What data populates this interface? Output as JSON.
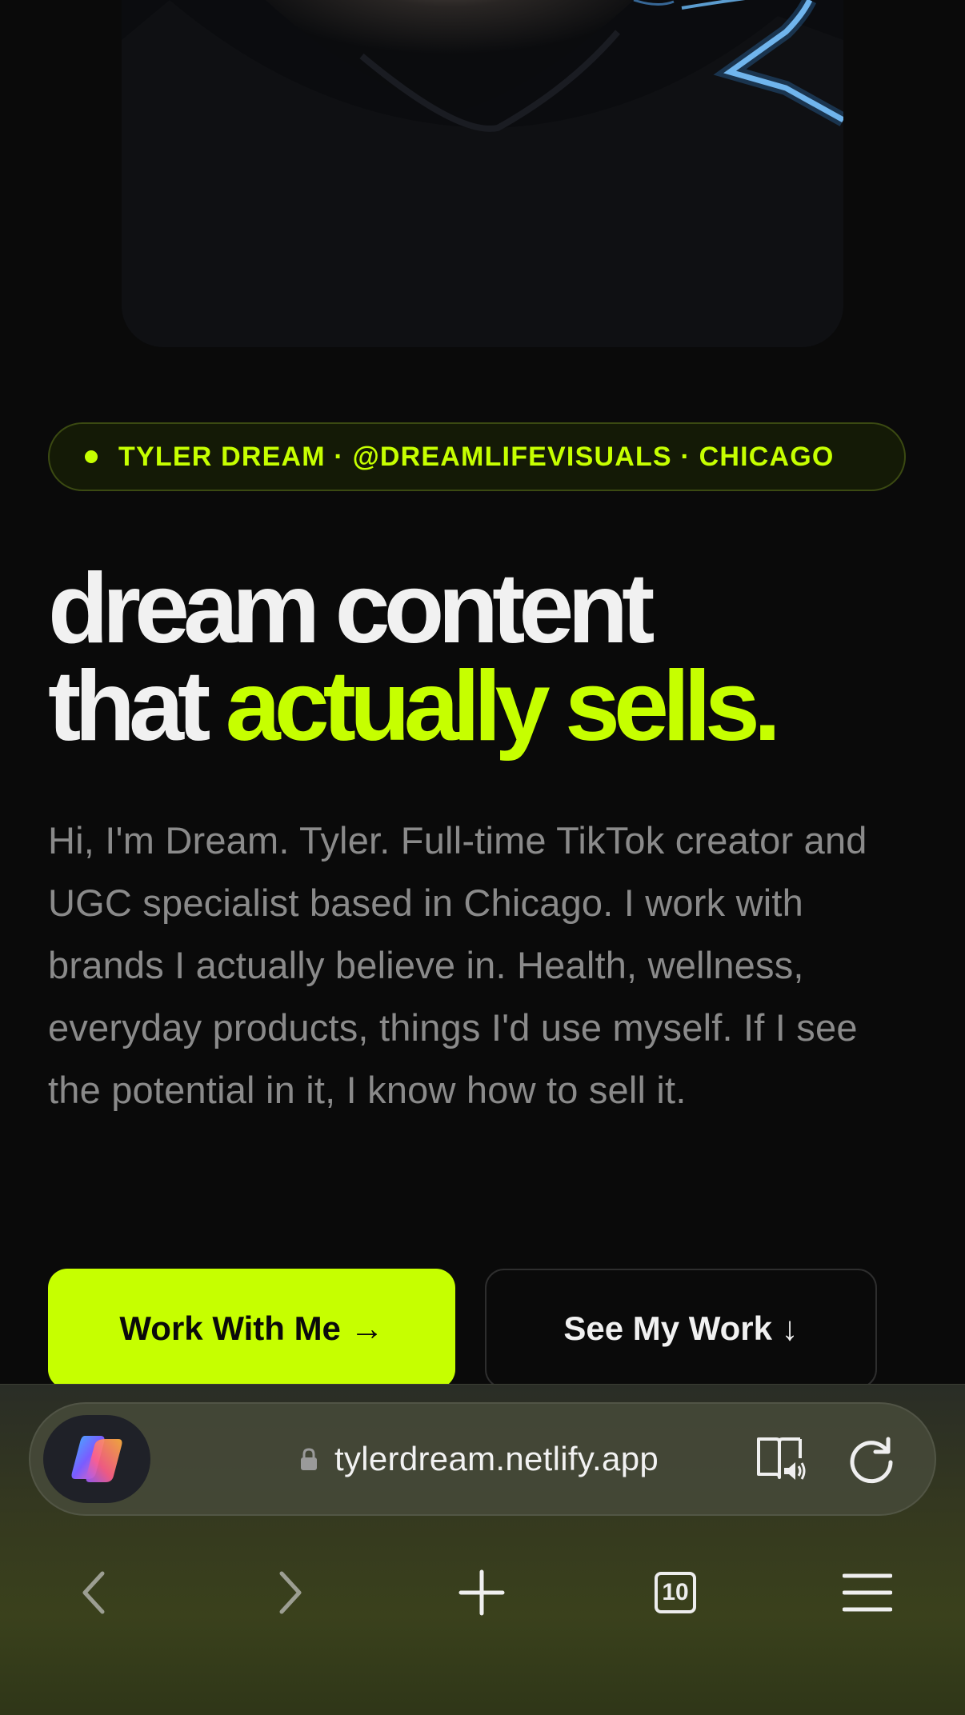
{
  "hero": {
    "tagline": "TYLER DREAM · @DREAMLIFEVISUALS · CHICAGO",
    "headline_line1": "dream content",
    "headline_line2_plain": "that",
    "headline_line2_accent": "actually sells.",
    "intro": "Hi, I'm Dream. Tyler. Full-time TikTok creator and UGC specialist based in Chicago. I work with brands I actually believe in. Health, wellness, everyday products, things I'd use myself. If I see the potential in it, I know how to sell it."
  },
  "cta": {
    "primary_label": "Work With Me →",
    "secondary_label": "See My Work ↓"
  },
  "browser": {
    "url": "tylerdream.netlify.app",
    "tab_count": "10",
    "icons": {
      "assistant": "copilot-icon",
      "lock": "lock-icon",
      "reader": "reader-mode-icon",
      "reload": "reload-icon",
      "back": "back-icon",
      "forward": "forward-icon",
      "new_tab": "plus-icon",
      "tabs": "tabs-icon",
      "menu": "menu-icon"
    }
  },
  "colors": {
    "accent": "#c6ff00",
    "background": "#0a0a0a",
    "headline": "#f1f1f1",
    "body_text": "#8a8a8a"
  }
}
